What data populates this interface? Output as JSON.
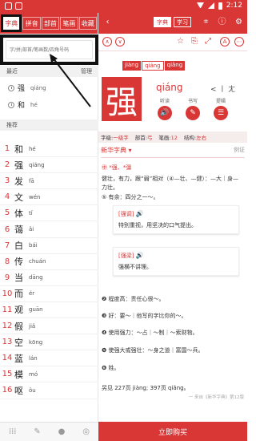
{
  "status": {
    "time": "2:12"
  },
  "tabs": [
    "字典",
    "拼音",
    "部首",
    "笔画",
    "收藏"
  ],
  "search": {
    "placeholder": "字/拼/部首/笔画数/四角号码"
  },
  "recent": {
    "title": "最近",
    "manage": "管理",
    "items": [
      {
        "char": "强",
        "pinyin": "qiáng"
      },
      {
        "char": "和",
        "pinyin": "hé"
      }
    ]
  },
  "recommend": {
    "title": "推荐",
    "items": [
      {
        "num": "1",
        "char": "和",
        "pinyin": "hé"
      },
      {
        "num": "2",
        "char": "强",
        "pinyin": "qiáng"
      },
      {
        "num": "3",
        "char": "发",
        "pinyin": "fā"
      },
      {
        "num": "4",
        "char": "文",
        "pinyin": "wén"
      },
      {
        "num": "5",
        "char": "体",
        "pinyin": "tǐ"
      },
      {
        "num": "6",
        "char": "蔼",
        "pinyin": "ǎi"
      },
      {
        "num": "7",
        "char": "白",
        "pinyin": "bái"
      },
      {
        "num": "8",
        "char": "传",
        "pinyin": "chuán"
      },
      {
        "num": "9",
        "char": "当",
        "pinyin": "dāng"
      },
      {
        "num": "10",
        "char": "而",
        "pinyin": "ér"
      },
      {
        "num": "11",
        "char": "观",
        "pinyin": "guān"
      },
      {
        "num": "12",
        "char": "假",
        "pinyin": "jiǎ"
      },
      {
        "num": "13",
        "char": "空",
        "pinyin": "kōng"
      },
      {
        "num": "14",
        "char": "蓝",
        "pinyin": "lán"
      },
      {
        "num": "15",
        "char": "模",
        "pinyin": "mó"
      },
      {
        "num": "16",
        "char": "呕",
        "pinyin": "ǒu"
      }
    ]
  },
  "header": {
    "title_btn": "字典",
    "study_btn": "学习"
  },
  "entry": {
    "char": "强",
    "pinyins": [
      "jiàng",
      "qiáng",
      "qiǎng"
    ],
    "pinyin": "qiáng",
    "radical_info": "< 丨 ㄤ",
    "icons": [
      {
        "label": "听读",
        "glyph": "🔊"
      },
      {
        "label": "书写",
        "glyph": "✎"
      },
      {
        "label": "提辑",
        "glyph": "☰"
      }
    ],
    "info": {
      "zijí_label": "字级:",
      "zijí": "一级字",
      "bushou_label": "部首:",
      "bushou": "弓",
      "bihua_label": "笔画:",
      "bihua": "12",
      "jiegou_label": "结构:",
      "jiegou": "左右"
    }
  },
  "dict": {
    "title": "新华字典 ▾",
    "example": "例证",
    "origin": "㊥ *强、*彊",
    "def1": "健壮，有力，跟“弱”相对（④—壮、—健）：—大｜身—力壮。",
    "def1_sub": "⑤ 有余：四分之一～。",
    "card1": {
      "tag": "[强调]",
      "text": "特别重视，用坚决的口气提出。"
    },
    "card2": {
      "tag": "[强梁]",
      "text": "强横不讲理。"
    },
    "def2": "❷ 程度高：责任心很～。",
    "def3": "❸ 好：要～｜他写的字比你的～。",
    "def4": "❹ 使用强力：～占｜～制｜～索财物。",
    "def5": "❺ 使强大或强壮：～身之道｜富国～兵。",
    "def6": "❻ 姓。",
    "see_also": "另见 227页 jiàng; 397页 qiǎng。",
    "source": "一 来自《新华字典》第12版"
  },
  "buy_label": "立即购买"
}
